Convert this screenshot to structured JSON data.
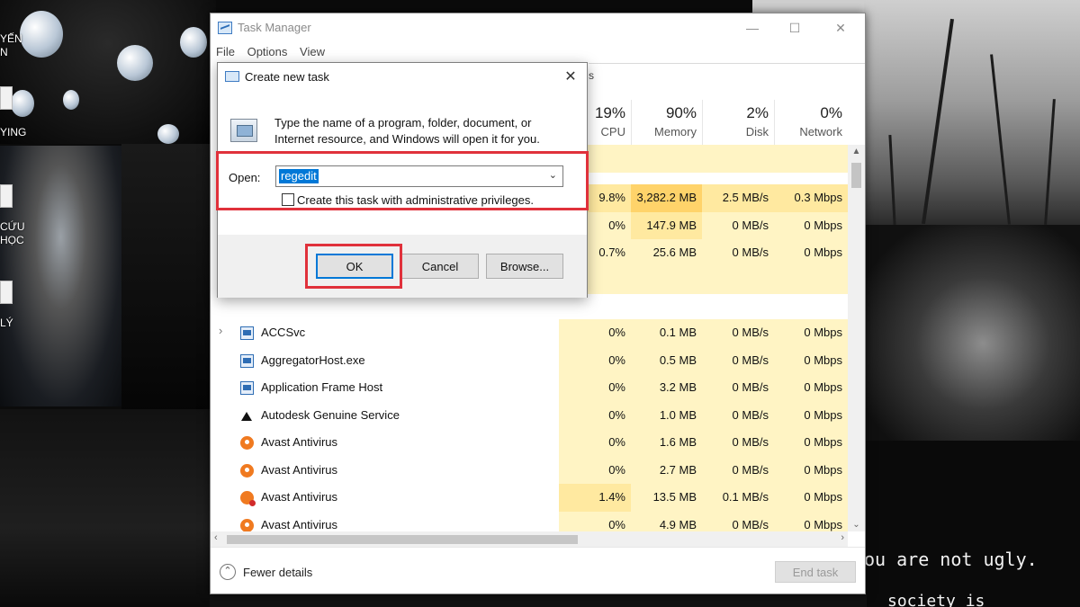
{
  "desktop": {
    "icons": [
      {
        "label_lines": [
          "YẾN",
          "N"
        ]
      },
      {
        "label_lines": [
          "YING"
        ]
      },
      {
        "label_lines": [
          "CỨU",
          "HỌC"
        ]
      },
      {
        "label_lines": [
          "LÝ"
        ]
      }
    ],
    "wallpaper_text": {
      "line1": "ou are not ugly.",
      "line2": "society is"
    }
  },
  "task_manager": {
    "title": "Task Manager",
    "menu": [
      "File",
      "Options",
      "View"
    ],
    "tab_fragment": "s",
    "columns": [
      {
        "percent": "19%",
        "name": "CPU"
      },
      {
        "percent": "90%",
        "name": "Memory"
      },
      {
        "percent": "2%",
        "name": "Disk"
      },
      {
        "percent": "0%",
        "name": "Network"
      }
    ],
    "hidden_rows": [
      {
        "cpu": "9.8%",
        "memory": "3,282.2 MB",
        "disk": "2.5 MB/s",
        "network": "0.3 Mbps"
      },
      {
        "cpu": "0%",
        "memory": "147.9 MB",
        "disk": "0 MB/s",
        "network": "0 Mbps"
      },
      {
        "cpu": "0.7%",
        "memory": "25.6 MB",
        "disk": "0 MB/s",
        "network": "0 Mbps"
      }
    ],
    "processes": [
      {
        "name": "ACCSvc",
        "icon": "app-window-icon",
        "expandable": true,
        "cpu": "0%",
        "memory": "0.1 MB",
        "disk": "0 MB/s",
        "network": "0 Mbps"
      },
      {
        "name": "AggregatorHost.exe",
        "icon": "app-window-icon",
        "expandable": false,
        "cpu": "0%",
        "memory": "0.5 MB",
        "disk": "0 MB/s",
        "network": "0 Mbps"
      },
      {
        "name": "Application Frame Host",
        "icon": "app-window-icon",
        "expandable": false,
        "cpu": "0%",
        "memory": "3.2 MB",
        "disk": "0 MB/s",
        "network": "0 Mbps"
      },
      {
        "name": "Autodesk Genuine Service",
        "icon": "autodesk-icon",
        "expandable": false,
        "cpu": "0%",
        "memory": "1.0 MB",
        "disk": "0 MB/s",
        "network": "0 Mbps"
      },
      {
        "name": "Avast Antivirus",
        "icon": "avast-icon",
        "expandable": false,
        "cpu": "0%",
        "memory": "1.6 MB",
        "disk": "0 MB/s",
        "network": "0 Mbps"
      },
      {
        "name": "Avast Antivirus",
        "icon": "avast-icon",
        "expandable": false,
        "cpu": "0%",
        "memory": "2.7 MB",
        "disk": "0 MB/s",
        "network": "0 Mbps"
      },
      {
        "name": "Avast Antivirus",
        "icon": "avast-alert-icon",
        "expandable": false,
        "cpu": "1.4%",
        "memory": "13.5 MB",
        "disk": "0.1 MB/s",
        "network": "0 Mbps"
      },
      {
        "name": "Avast Antivirus",
        "icon": "avast-icon",
        "expandable": false,
        "cpu": "0%",
        "memory": "4.9 MB",
        "disk": "0 MB/s",
        "network": "0 Mbps"
      }
    ],
    "footer": {
      "fewer_details": "Fewer details",
      "end_task": "End task"
    }
  },
  "dialog": {
    "title": "Create new task",
    "description": "Type the name of a program, folder, document, or Internet resource, and Windows will open it for you.",
    "open_label": "Open:",
    "open_value": "regedit",
    "admin_checkbox_label": "Create this task with administrative privileges.",
    "admin_checked": false,
    "buttons": {
      "ok": "OK",
      "cancel": "Cancel",
      "browse": "Browse..."
    }
  },
  "annotation_color": "#e0313b"
}
